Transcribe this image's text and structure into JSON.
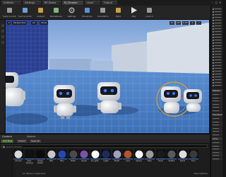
{
  "tabs": [
    {
      "label": "Untitled",
      "active": false
    },
    {
      "label": "Settings",
      "active": false
    },
    {
      "label": "BP_Robot",
      "active": false
    },
    {
      "label": "M_Chrome",
      "active": true
    },
    {
      "label": "Level",
      "active": false
    },
    {
      "label": "Output",
      "active": false
    }
  ],
  "toolbar": {
    "buttons": [
      {
        "label": "Save Current",
        "icon": "save-icon"
      },
      {
        "label": "Source Control",
        "icon": "source-control-icon"
      },
      {
        "label": "Content",
        "icon": "content-icon"
      },
      {
        "label": "Marketplace",
        "icon": "marketplace-icon"
      },
      {
        "label": "Settings",
        "icon": "settings-icon"
      },
      {
        "label": "Blueprints",
        "icon": "blueprints-icon"
      },
      {
        "label": "Cinematics",
        "icon": "cinematics-icon"
      },
      {
        "label": "Build",
        "icon": "build-icon"
      },
      {
        "label": "Play",
        "icon": "play-icon"
      },
      {
        "label": "Launch",
        "icon": "launch-icon"
      }
    ]
  },
  "viewport": {
    "view_mode": "Perspective",
    "lit_mode": "Lit",
    "show": "Show",
    "grid_snap": "10",
    "rot_snap": "10°",
    "scale_snap": "0.25",
    "camera_speed": "4"
  },
  "right_panel": {
    "sections": [
      "Details",
      "Transform",
      "Actor"
    ]
  },
  "content_browser": {
    "tab_label": "Content",
    "tab_label_2": "Models",
    "add_button": "Add New",
    "import_button": "Import",
    "save_all_button": "Save All",
    "filters_button": "Filters",
    "search_placeholder": "Search Models",
    "assets": [
      {
        "name": "Chrome",
        "color": "#d8d8d8"
      },
      {
        "name": "Dark Shading Rubber",
        "color": "#111111"
      },
      {
        "name": "Glossy Plastic",
        "color": "#0b0b0b"
      },
      {
        "name": "Wall",
        "color": "#c6c6c6"
      },
      {
        "name": "Blue",
        "color": "#2546b8"
      },
      {
        "name": "Metal",
        "color": "#4a4a4a"
      },
      {
        "name": "Purple",
        "color": "#7a52a8"
      },
      {
        "name": "M_Lights",
        "color": "#ffffff"
      },
      {
        "name": "Lights",
        "color": "#1c2a60"
      },
      {
        "name": "Bright",
        "color": "#9ea0c0"
      },
      {
        "name": "Lava",
        "color": "#b5542a"
      },
      {
        "name": "Sphere",
        "color": "#ffffff"
      },
      {
        "name": "Base",
        "color": "#9a9a9a"
      },
      {
        "name": "Decal",
        "color": "#1b1b1b"
      },
      {
        "name": "SkyBox",
        "color": "#5a5a5a"
      },
      {
        "name": "Robot",
        "color": "#dddddd"
      },
      {
        "name": "Floor",
        "color": "#3a3a3a"
      }
    ],
    "status": "11 items (1 selected)",
    "view_options": "View Options"
  },
  "accent_color": "#4a7bd0"
}
